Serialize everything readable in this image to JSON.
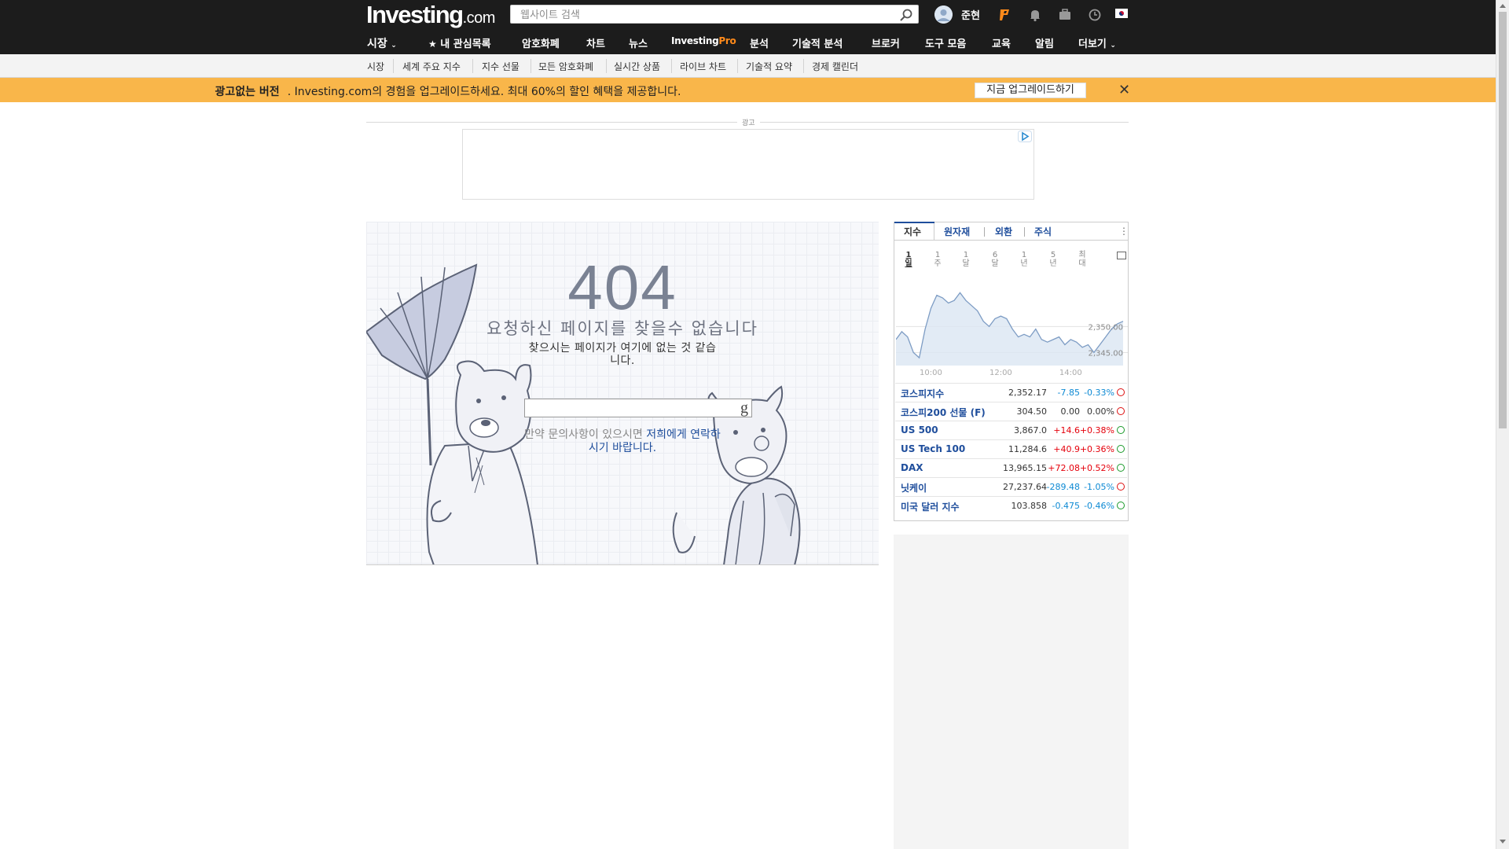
{
  "header": {
    "logo_main": "Investing",
    "logo_suffix": ".com",
    "search_placeholder": "웹사이트 검색",
    "username": "준현",
    "icons": [
      "magnifier-icon",
      "avatar-icon",
      "investingpro-icon",
      "bell-icon",
      "briefcase-icon",
      "clock-icon",
      "korea-flag-icon"
    ]
  },
  "nav": {
    "items": [
      {
        "label": "시장",
        "has_dropdown": true
      },
      {
        "label": "내 관심목록",
        "icon": "star-icon"
      },
      {
        "label": "암호화폐"
      },
      {
        "label": "차트"
      },
      {
        "label": "뉴스"
      },
      {
        "label": "Investing",
        "pro": "Pro"
      },
      {
        "label": "분석"
      },
      {
        "label": "기술적 분석"
      },
      {
        "label": "브로커"
      },
      {
        "label": "도구 모음"
      },
      {
        "label": "교육"
      },
      {
        "label": "알림"
      },
      {
        "label": "더보기",
        "has_dropdown": true
      }
    ]
  },
  "subnav": [
    "시장",
    "세계 주요 지수",
    "지수 선물",
    "모든 암호화폐",
    "실시간 상품",
    "라이브 차트",
    "기술적 요약",
    "경제 캘린더"
  ],
  "promo": {
    "bold": "광고없는 버전",
    "text": ". Investing.com의 경험을 업그레이드하세요. 최대 60%의 할인 혜택을 제공합니다.",
    "button": "지금 업그레이드하기",
    "close": "✕",
    "background": "#f9b64a"
  },
  "ad": {
    "label": "광고"
  },
  "error": {
    "code": "404",
    "title": "요청하신 페이지를 찾을수 없습니다",
    "subtitle": "찾으시는 페이지가 여기에 없는 것 같습니다.",
    "search_button": "g",
    "contact_prefix": "만약 문의사항이 있으시면 ",
    "contact_link": "저희에게 연락하시기 바랍니다."
  },
  "widget": {
    "tabs": [
      "지수",
      "원자재",
      "외환",
      "주식"
    ],
    "active_tab": "지수",
    "periods": [
      {
        "num": "1",
        "unit": "일"
      },
      {
        "num": "1",
        "unit": "주"
      },
      {
        "num": "1",
        "unit": "달"
      },
      {
        "num": "6",
        "unit": "달"
      },
      {
        "num": "1",
        "unit": "년"
      },
      {
        "num": "5",
        "unit": "년"
      },
      {
        "num": "최",
        "unit": "대"
      }
    ],
    "active_period": "1일",
    "quotes": [
      {
        "name": "코스피지수",
        "last": "2,352.17",
        "change": "-7.85",
        "pct": "-0.33%",
        "dir": "down",
        "status": "closed"
      },
      {
        "name": "코스피200 선물 (F)",
        "last": "304.50",
        "change": "0.00",
        "pct": "0.00%",
        "dir": "flat",
        "status": "closed"
      },
      {
        "name": "US 500",
        "last": "3,867.0",
        "change": "+14.6",
        "pct": "+0.38%",
        "dir": "up",
        "status": "open"
      },
      {
        "name": "US Tech 100",
        "last": "11,284.6",
        "change": "+40.9",
        "pct": "+0.36%",
        "dir": "up",
        "status": "open"
      },
      {
        "name": "DAX",
        "last": "13,965.15",
        "change": "+72.08",
        "pct": "+0.52%",
        "dir": "up",
        "status": "open"
      },
      {
        "name": "닛케이",
        "last": "27,237.64",
        "change": "-289.48",
        "pct": "-1.05%",
        "dir": "down",
        "status": "closed"
      },
      {
        "name": "미국 달러 지수",
        "last": "103.858",
        "change": "-0.475",
        "pct": "-0.46%",
        "dir": "down",
        "status": "open"
      }
    ],
    "colors": {
      "up": "#e5000b",
      "down": "#0e8ad4",
      "link": "#1f4e9c"
    }
  },
  "chart_data": {
    "type": "area",
    "x": [
      "09:00",
      "09:10",
      "09:20",
      "09:30",
      "09:40",
      "09:50",
      "10:00",
      "10:10",
      "10:20",
      "10:30",
      "10:40",
      "10:50",
      "11:00",
      "11:10",
      "11:20",
      "11:30",
      "11:40",
      "11:50",
      "12:00",
      "12:10",
      "12:20",
      "12:30",
      "12:40",
      "12:50",
      "13:00",
      "13:10",
      "13:20",
      "13:30",
      "13:40",
      "13:50",
      "14:00",
      "14:10",
      "14:20",
      "14:30",
      "14:40",
      "14:50",
      "15:00",
      "15:10",
      "15:20",
      "15:30"
    ],
    "series": [
      {
        "values": [
          2347.5,
          2349.0,
          2348.0,
          2345.0,
          2344.0,
          2349.5,
          2353.5,
          2356.0,
          2355.5,
          2354.5,
          2355.0,
          2356.5,
          2355.0,
          2354.0,
          2353.0,
          2351.0,
          2350.0,
          2351.5,
          2352.0,
          2351.5,
          2349.5,
          2348.0,
          2348.5,
          2348.0,
          2349.5,
          2347.5,
          2347.0,
          2347.5,
          2348.0,
          2346.5,
          2347.5,
          2347.0,
          2346.0,
          2346.5,
          2345.0,
          2346.5,
          2348.0,
          2349.5,
          2350.5,
          2351.0
        ]
      }
    ],
    "xticks": [
      "10:00",
      "12:00",
      "14:00"
    ],
    "yticks": [
      "2,350.00",
      "2,345.00"
    ],
    "ylim": [
      2342.5,
      2358.5
    ],
    "grid": true,
    "line_color": "#7d9cc4",
    "fill_color": "#dbe6f3"
  }
}
